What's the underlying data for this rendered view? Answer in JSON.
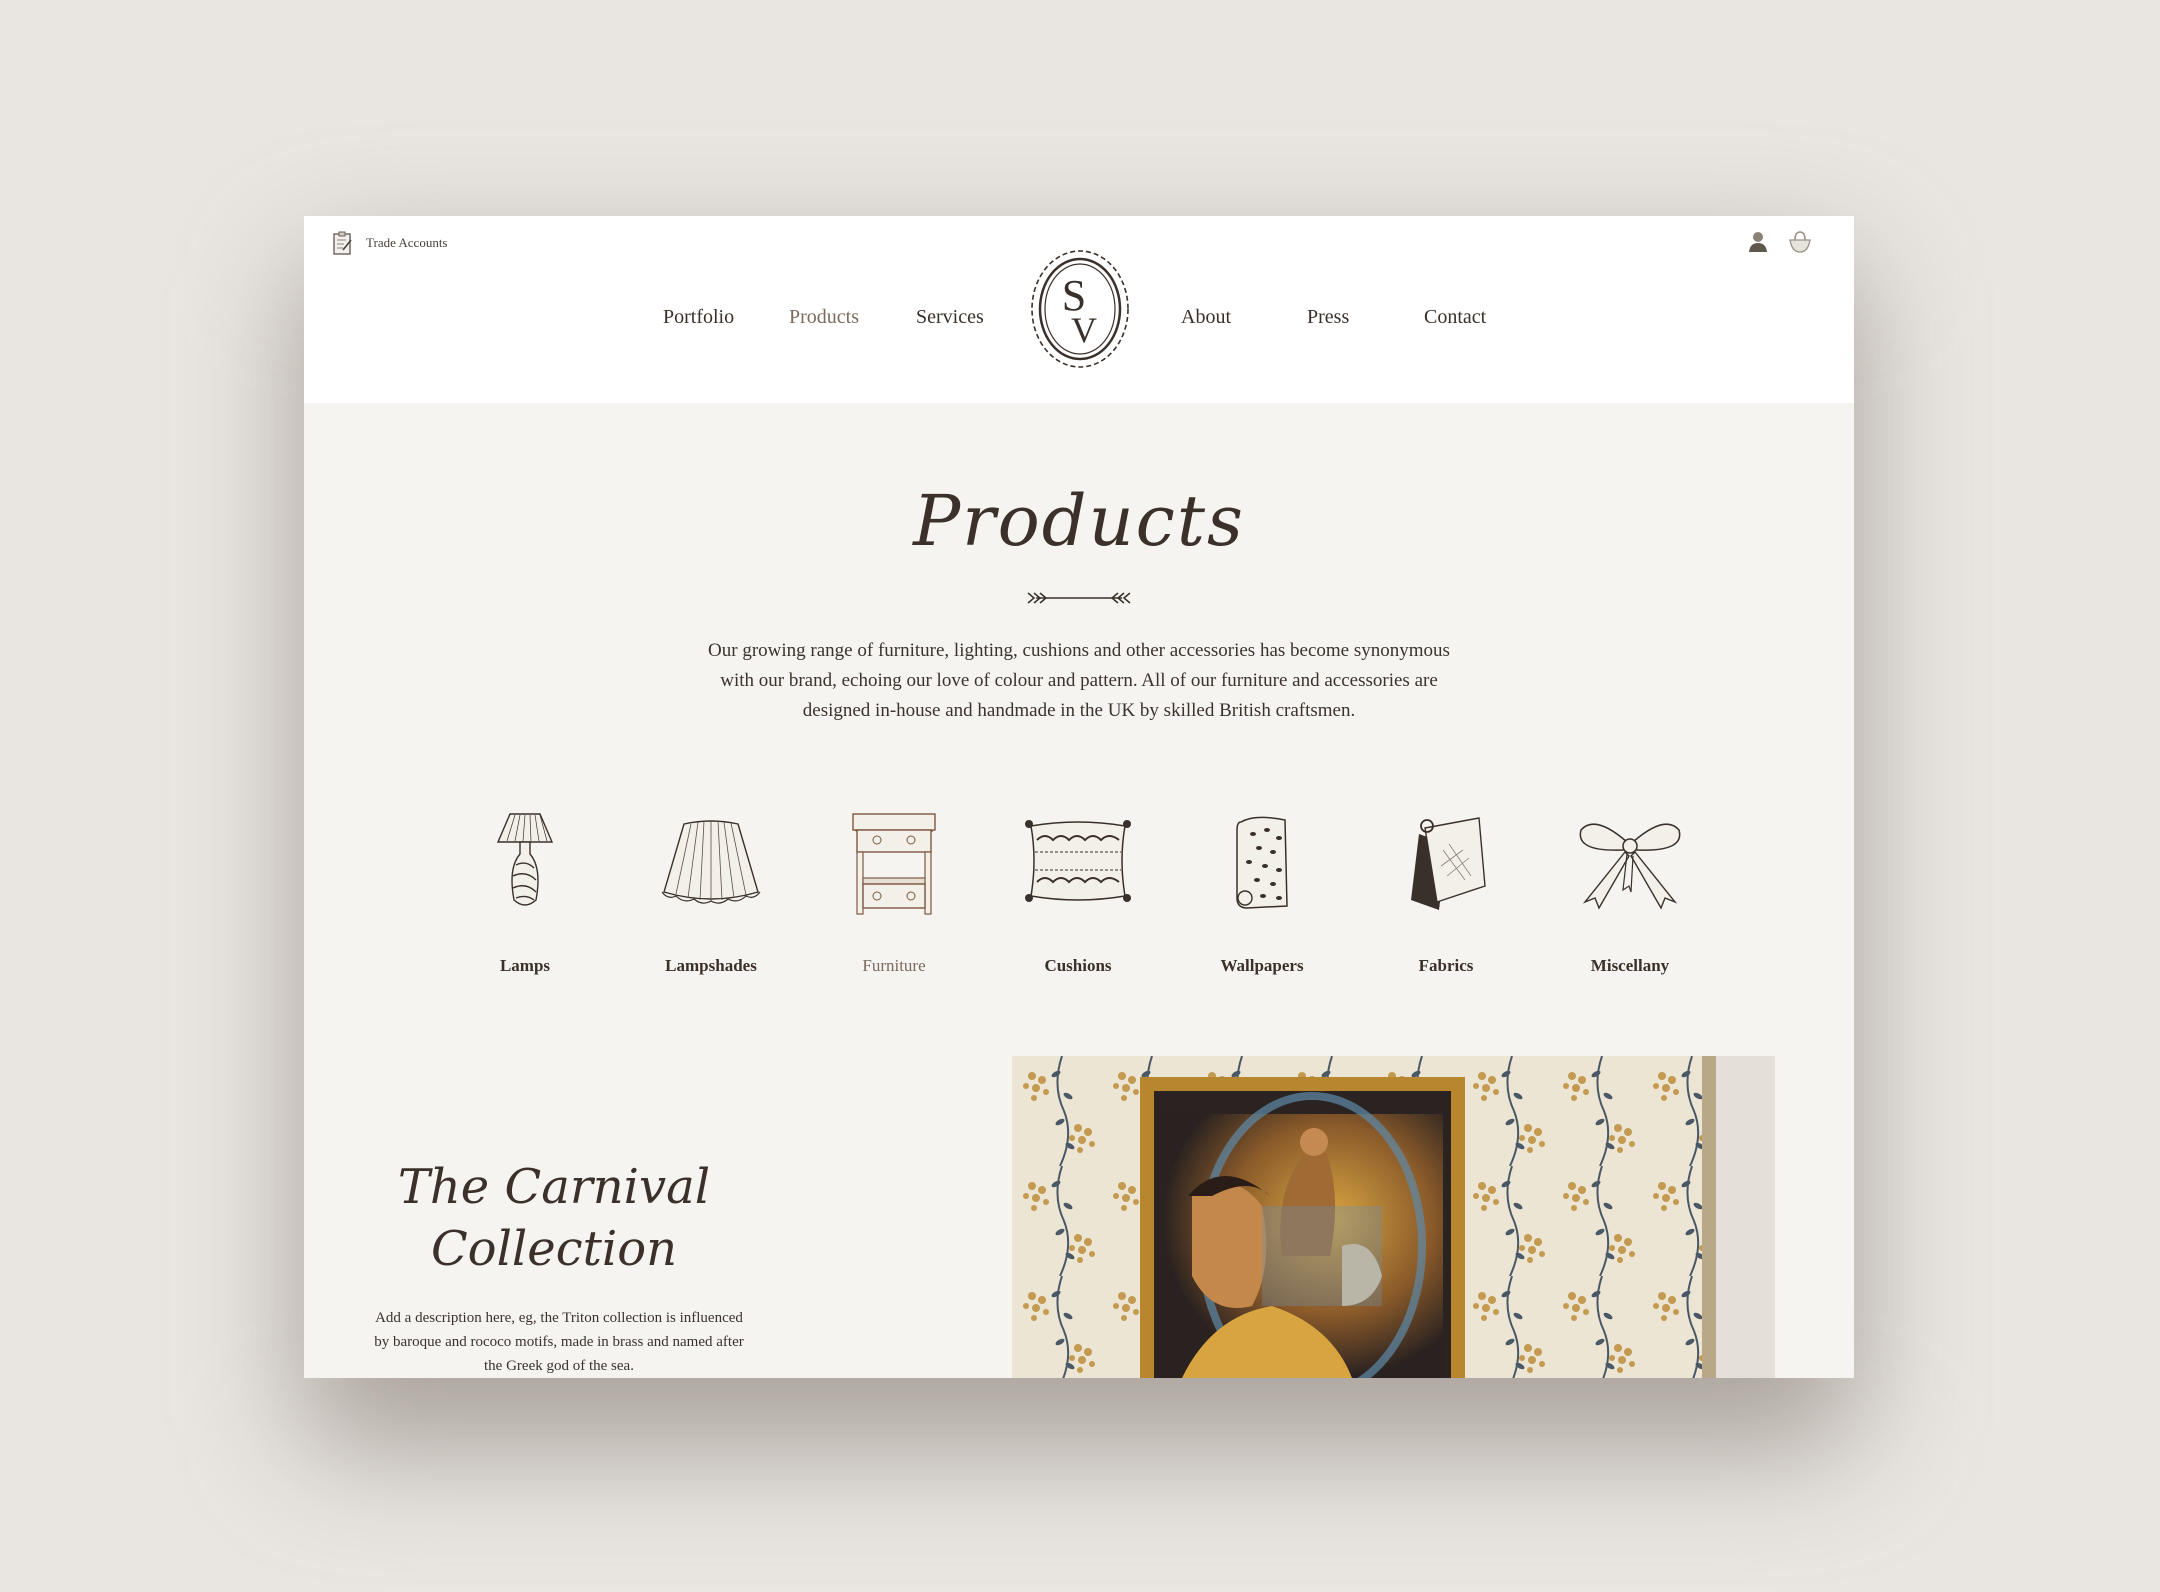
{
  "header": {
    "trade_accounts": "Trade Accounts",
    "nav_left": [
      {
        "label": "Portfolio",
        "active": false
      },
      {
        "label": "Products",
        "active": true
      },
      {
        "label": "Services",
        "active": false
      }
    ],
    "nav_right": [
      {
        "label": "About",
        "active": false
      },
      {
        "label": "Press",
        "active": false
      },
      {
        "label": "Contact",
        "active": false
      }
    ],
    "logo_monogram": [
      "S",
      "V"
    ],
    "icons": [
      "account-icon",
      "basket-icon"
    ]
  },
  "hero": {
    "title": "Products",
    "intro": "Our growing range of furniture, lighting, cushions and other accessories has become synonymous with our brand, echoing our love of colour and pattern. All of our furniture and accessories are designed in-house and handmade in the UK by skilled British craftsmen."
  },
  "categories": [
    {
      "label": "Lamps",
      "icon": "lamp-icon",
      "active": false
    },
    {
      "label": "Lampshades",
      "icon": "lampshade-icon",
      "active": false
    },
    {
      "label": "Furniture",
      "icon": "furniture-icon",
      "active": true
    },
    {
      "label": "Cushions",
      "icon": "cushion-icon",
      "active": false
    },
    {
      "label": "Wallpapers",
      "icon": "wallpaper-roll-icon",
      "active": false
    },
    {
      "label": "Fabrics",
      "icon": "fabric-swatch-icon",
      "active": false
    },
    {
      "label": "Miscellany",
      "icon": "bow-icon",
      "active": false
    }
  ],
  "collection": {
    "title_line1": "The Carnival",
    "title_line2": "Collection",
    "description": "Add a description here, eg, the Triton collection is influenced by baroque and rococo motifs, made in brass and named after the Greek god of the sea."
  },
  "colors": {
    "background": "#e9e6e1",
    "page": "#f6f4f1",
    "text": "#3a302a",
    "active": "#7d6a5c"
  }
}
